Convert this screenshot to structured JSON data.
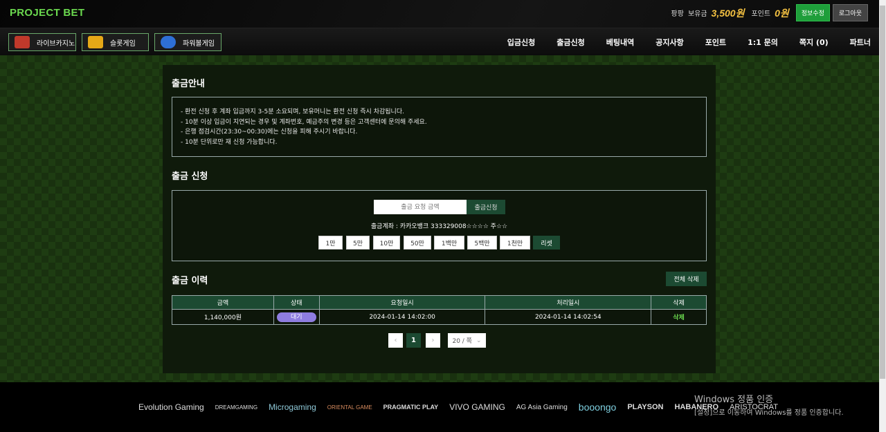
{
  "header": {
    "logo": "PROJECT BET",
    "username": "팡팡",
    "balance_label": "보유금",
    "balance": "3,500원",
    "point_label": "포인트",
    "point": "0원",
    "edit_button": "정보수정",
    "logout_button": "로그아웃"
  },
  "games": [
    {
      "label": "라이브카지노",
      "icon": "casino-chips-icon",
      "color": "#c0392b"
    },
    {
      "label": "슬롯게임",
      "icon": "slot-machine-icon",
      "color": "#e6a817"
    },
    {
      "label": "파워볼게임",
      "icon": "powerball-icon",
      "color": "#2e6fd6"
    }
  ],
  "nav": [
    "입금신청",
    "출금신청",
    "베팅내역",
    "공지사항",
    "포인트",
    "1:1 문의",
    "쪽지 (0)",
    "파트너"
  ],
  "notice": {
    "title": "출금안내",
    "lines": [
      "- 환전 신청 후 계좌 입금까지 3-5분 소요되며, 보유머니는 환전 신청 즉시 차감됩니다.",
      "- 10분 이상 입금이 지연되는 경우 및 계좌번호, 예금주의 변경 등은 고객센터에 문의해 주세요.",
      "- 은행 점검시간(23:30~00:30)에는 신청을 피해 주시기 바랍니다.",
      "- 10분 단위로만 재 신청 가능합니다."
    ]
  },
  "request": {
    "title": "출금 신청",
    "input_placeholder": "출금 요청 금액",
    "submit_button": "출금신청",
    "account_info": "출금계좌 : 카카오뱅크 333329008☆☆☆☆ 주☆☆",
    "quick_amounts": [
      "1만",
      "5만",
      "10만",
      "50만",
      "1백만",
      "5백만",
      "1천만"
    ],
    "reset_button": "리셋"
  },
  "history": {
    "title": "출금 이력",
    "delete_all_button": "전체 삭제",
    "columns": [
      "금액",
      "상태",
      "요청일시",
      "처리일시",
      "삭제"
    ],
    "rows": [
      {
        "amount": "1,140,000원",
        "status": "대기",
        "requested": "2024-01-14 14:02:00",
        "processed": "2024-01-14 14:02:54",
        "delete": "삭제"
      }
    ],
    "status_color": "#8e7de0"
  },
  "pagination": {
    "prev": "‹",
    "current": "1",
    "next": "›",
    "page_size": "20 / 쪽"
  },
  "footer": {
    "providers": [
      "Evolution Gaming",
      "DREAMGAMING",
      "Microgaming",
      "ORIENTAL GAME",
      "PRAGMATIC PLAY",
      "VIVO GAMING",
      "AG Asia Gaming",
      "booongo",
      "PLAYSON",
      "HABANERO",
      "ARISTOCRAT"
    ],
    "windows_title": "Windows 정품 인증",
    "windows_sub": "[설정]으로 이동하여 Windows를 정품 인증합니다."
  },
  "colors": {
    "brand_green": "#6bd94f",
    "button_green": "#1c4a32",
    "balance_gold": "#f5c242"
  }
}
